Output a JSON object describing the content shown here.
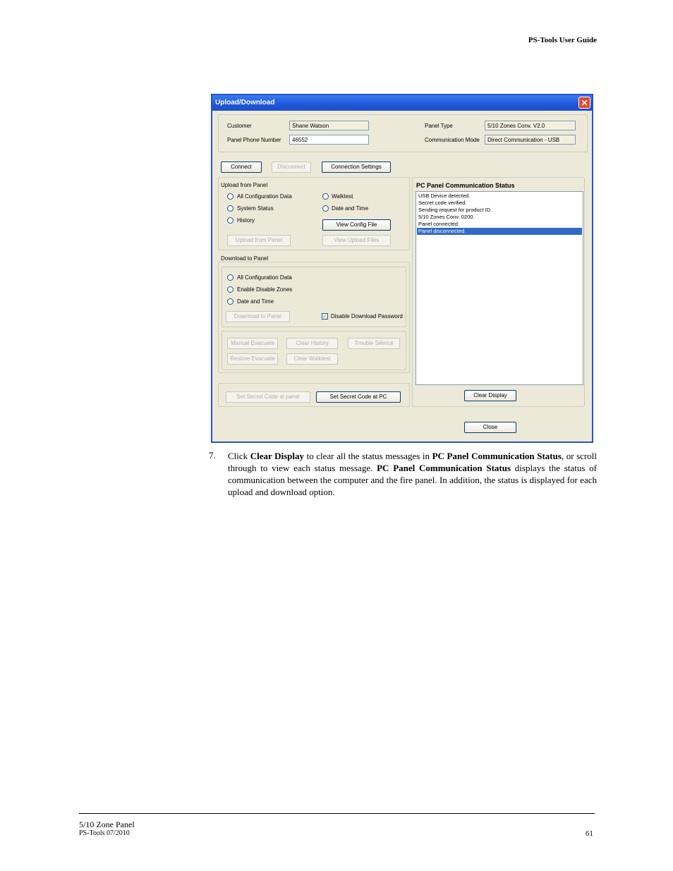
{
  "header": {
    "title": "PS-Tools User Guide"
  },
  "dialog": {
    "title": "Upload/Download",
    "close_glyph": "✕",
    "customer_label": "Customer",
    "customer_value": "Shane Watson",
    "panel_phone_label": "Panel Phone Number",
    "panel_phone_value": "46552",
    "panel_type_label": "Panel Type",
    "panel_type_value": "5/10 Zones Conv. V2.0",
    "comm_mode_label": "Communication Mode",
    "comm_mode_value": "Direct Communication - USB",
    "connect": "Connect",
    "disconnect": "Disconnect",
    "connection_settings": "Connection Settings",
    "upload_group": "Upload from Panel",
    "upload_options": [
      "All Configuration Data",
      "System Status",
      "History",
      "Walktest",
      "Date and Time"
    ],
    "view_config_file": "View Config File",
    "upload_from_panel": "Upload from Panel",
    "view_upload_files": "View Upload Files",
    "download_group": "Download to Panel",
    "download_options": [
      "All Configuration Data",
      "Enable Disable Zones",
      "Date and Time"
    ],
    "download_to_panel": "Download to Panel",
    "disable_download_password": "Disable Download Password",
    "manual_evacuate": "Manual Evacuate",
    "clear_history": "Clear History",
    "trouble_silence": "Trouble Silence",
    "restore_evacuate": "Restore Evacuate",
    "clear_walktest": "Clear Walktest",
    "set_secret_panel": "Set Secret Code at panel",
    "set_secret_pc": "Set Secret Code at PC",
    "status_title": "PC Panel Communication Status",
    "status_lines": [
      "USB Device detected.",
      "Secret code verified.",
      "Sending request for product ID.",
      "5/10 Zones Conv. 0200.",
      "Panel connected.",
      "Panel disconnected."
    ],
    "clear_display": "Clear Display",
    "close": "Close"
  },
  "body": {
    "step_number": "7.",
    "step_parts": [
      "Click ",
      "Clear Display",
      " to clear all the status messages in ",
      "PC Panel Communication Status",
      ", or scroll through to view each status message. ",
      "PC Panel Communication Status",
      " displays the status of communication between the computer and the fire panel. In addition, the status is displayed for each upload and download option."
    ]
  },
  "footer": {
    "line1": "5/10 Zone Panel",
    "line2": "PS-Tools 07/2010",
    "page": "61"
  }
}
